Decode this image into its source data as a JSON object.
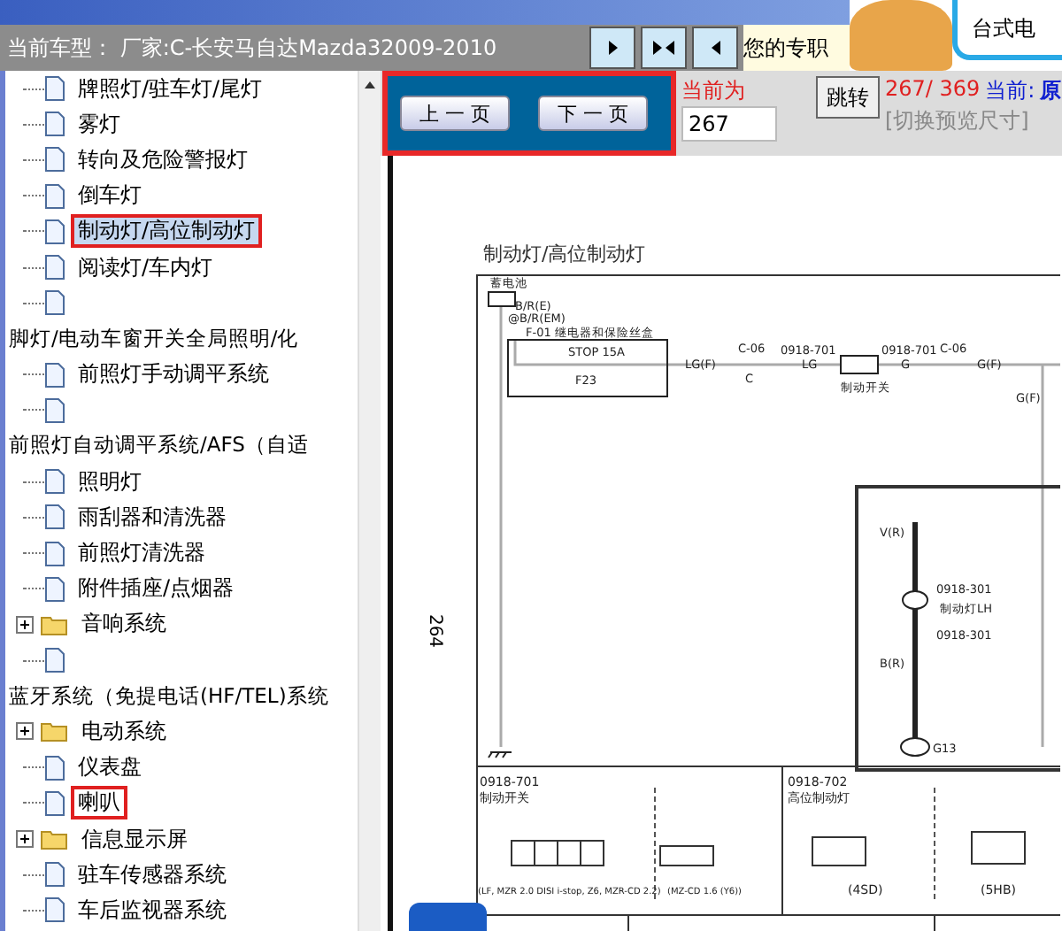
{
  "header": {
    "title": "当前车型：  厂家:C-长安马自达Mazda32009-2010",
    "promo_text": "您的专职",
    "ad_text": "台式电"
  },
  "tree": [
    {
      "label": "牌照灯/驻车灯/尾灯",
      "kind": "leaf",
      "selected": false,
      "highlighted": false
    },
    {
      "label": "雾灯",
      "kind": "leaf",
      "selected": false,
      "highlighted": false
    },
    {
      "label": "转向及危险警报灯",
      "kind": "leaf",
      "selected": false,
      "highlighted": false
    },
    {
      "label": "倒车灯",
      "kind": "leaf",
      "selected": false,
      "highlighted": false
    },
    {
      "label": "制动灯/高位制动灯",
      "kind": "leaf",
      "selected": true,
      "highlighted": true
    },
    {
      "label": "阅读灯/车内灯",
      "kind": "leaf",
      "selected": false,
      "highlighted": false
    },
    {
      "kind": "leaf"
    },
    {
      "label": "脚灯/电动车窗开关全局照明/化",
      "kind": "text"
    },
    {
      "label": "前照灯手动调平系统",
      "kind": "leaf",
      "selected": false,
      "highlighted": false
    },
    {
      "kind": "leaf"
    },
    {
      "label": "前照灯自动调平系统/AFS（自适",
      "kind": "text"
    },
    {
      "label": "照明灯",
      "kind": "leaf",
      "selected": false,
      "highlighted": false
    },
    {
      "label": "雨刮器和清洗器",
      "kind": "leaf",
      "selected": false,
      "highlighted": false
    },
    {
      "label": "前照灯清洗器",
      "kind": "leaf",
      "selected": false,
      "highlighted": false
    },
    {
      "label": "附件插座/点烟器",
      "kind": "leaf",
      "selected": false,
      "highlighted": false
    },
    {
      "label": "音响系统",
      "kind": "folder",
      "expanded": false,
      "selected": false,
      "highlighted": false
    },
    {
      "kind": "leaf"
    },
    {
      "label": "蓝牙系统（免提电话(HF/TEL)系统",
      "kind": "text"
    },
    {
      "label": "电动系统",
      "kind": "folder",
      "expanded": false,
      "selected": false,
      "highlighted": false
    },
    {
      "label": "仪表盘",
      "kind": "leaf",
      "selected": false,
      "highlighted": false
    },
    {
      "label": "喇叭",
      "kind": "leaf",
      "selected": false,
      "highlighted": true
    },
    {
      "label": "信息显示屏",
      "kind": "folder",
      "expanded": false,
      "selected": false,
      "highlighted": false
    },
    {
      "label": "驻车传感器系统",
      "kind": "leaf",
      "selected": false,
      "highlighted": false
    },
    {
      "label": "车后监视器系统",
      "kind": "leaf",
      "selected": false,
      "highlighted": false
    }
  ],
  "toolbar": {
    "highlighted": true,
    "prev_button": "上 一 页",
    "next_button": "下 一 页",
    "page_label": "当前为",
    "page_value": "267",
    "jump_button": "跳转",
    "counter": "267/ 369",
    "current_label": "当前:",
    "current_value": "原",
    "resize_link": "[切换预览尺寸]"
  },
  "diagram": {
    "title": "制动灯/高位制动灯",
    "page_number": "264",
    "labels": [
      "蓄电池",
      "B/R(E)",
      "@B/R(EM)",
      "F-01 继电器和保险丝盒",
      "STOP 15A",
      "F23",
      "LG(F)",
      "C-06",
      "C",
      "0918-701",
      "LG",
      "制动开关",
      "0918-701",
      "G",
      "C-06",
      "G(F)",
      "G(F)",
      "V(R)",
      "0918-301",
      "制动灯LH",
      "0918-301",
      "B(R)",
      "G13",
      "0918-701",
      "制动开关",
      "(LF, MZR 2.0 DISI i-stop, Z6, MZR-CD 2.2)",
      "(MZ-CD 1.6 (Y6))",
      "0918-702",
      "高位制动灯",
      "(4SD)",
      "(5HB)"
    ]
  }
}
